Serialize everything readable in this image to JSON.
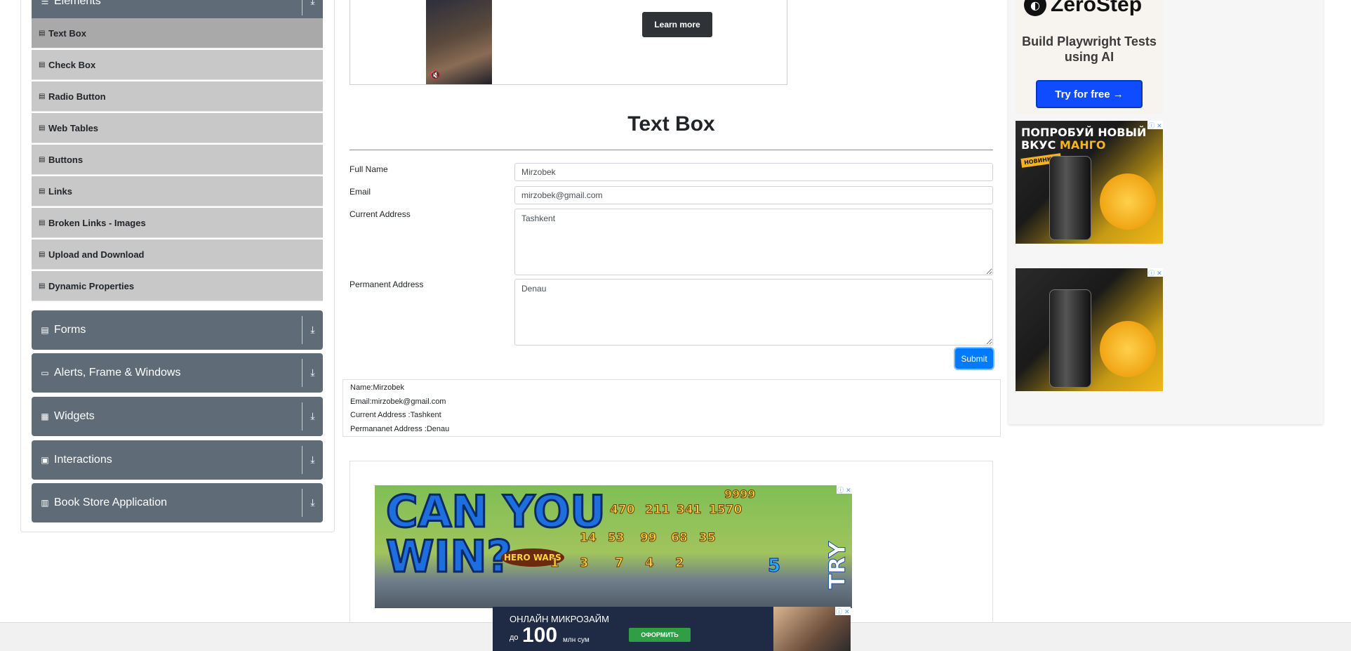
{
  "sidebar": {
    "elements_header": {
      "label": "Elements"
    },
    "menu_items": [
      {
        "label": "Text Box",
        "active": true
      },
      {
        "label": "Check Box",
        "active": false
      },
      {
        "label": "Radio Button",
        "active": false
      },
      {
        "label": "Web Tables",
        "active": false
      },
      {
        "label": "Buttons",
        "active": false
      },
      {
        "label": "Links",
        "active": false
      },
      {
        "label": "Broken Links - Images",
        "active": false
      },
      {
        "label": "Upload and Download",
        "active": false
      },
      {
        "label": "Dynamic Properties",
        "active": false
      }
    ],
    "groups": [
      {
        "label": "Forms",
        "icon": "form-icon"
      },
      {
        "label": "Alerts, Frame & Windows",
        "icon": "window-icon"
      },
      {
        "label": "Widgets",
        "icon": "widgets-icon"
      },
      {
        "label": "Interactions",
        "icon": "interactions-icon"
      },
      {
        "label": "Book Store Application",
        "icon": "book-icon"
      }
    ]
  },
  "top_ad": {
    "button_label": "Learn more",
    "mute_icon": "mute-icon"
  },
  "main": {
    "title": "Text Box",
    "form": {
      "full_name": {
        "label": "Full Name",
        "value": "Mirzobek"
      },
      "email": {
        "label": "Email",
        "value": "mirzobek@gmail.com"
      },
      "current_address": {
        "label": "Current Address",
        "value": "Tashkent"
      },
      "permanent_address": {
        "label": "Permanent Address",
        "value": "Denau"
      },
      "submit_label": "Submit"
    },
    "output": {
      "name": "Name:Mirzobek",
      "email": "Email:mirzobek@gmail.com",
      "current_address": "Current Address :Tashkent",
      "permanent_address": "Permananet Address :Denau"
    }
  },
  "right_ads": {
    "zerostep": {
      "brand": "ZeroStep",
      "tagline": "Build Playwright Tests using AI",
      "button": "Try for free →"
    },
    "mango_1": {
      "line1": "ПОПРОБУЙ НОВЫЙ",
      "line2_prefix": "ВКУС ",
      "line2_highlight": "МАНГО",
      "badge": "НОВИНКА!"
    }
  },
  "bottom_ads": {
    "game": {
      "headline_1": "CAN YOU",
      "headline_2": "WIN?",
      "cta": "TRY",
      "logo": "HERO WARS",
      "numbers_top": [
        "470",
        "211",
        "341",
        "1570"
      ],
      "number_corner": "9999",
      "numbers_mid": [
        "14",
        "53",
        "99",
        "68",
        "35"
      ],
      "numbers_bottom": [
        "1",
        "3",
        "7",
        "4",
        "2"
      ],
      "hero_power": "5"
    },
    "loan": {
      "title": "ОНЛАЙН МИКРОЗАЙМ",
      "prefix": "до",
      "amount": "100",
      "unit": "млн сум",
      "button": "ОФОРМИТЬ"
    }
  },
  "colors": {
    "sidebar_header": "#5f6b76",
    "menu_item": "#c8c8c8",
    "menu_active": "#a9a9a9",
    "submit": "#007bff",
    "zs_button": "#0f4cff"
  }
}
